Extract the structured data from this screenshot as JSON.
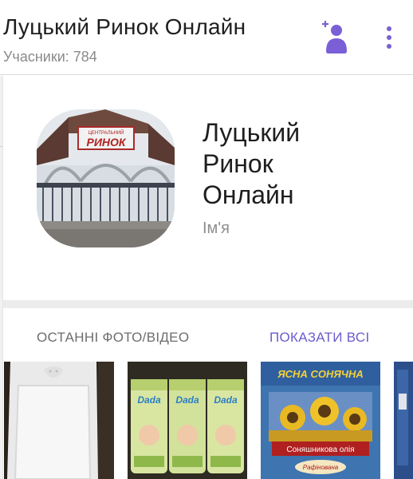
{
  "header": {
    "title": "Луцький Ринок Онлайн",
    "members_label": "Учасники: 784",
    "add_member_icon": "add-person-icon",
    "more_icon": "more-vertical-icon"
  },
  "profile": {
    "avatar_sign_text": "РИНОК",
    "avatar_sign_top_text": "ЦЕНТРАЛЬНИЙ",
    "name_lines": [
      "Луцький",
      "Ринок",
      "Онлайн"
    ],
    "name_caption": "Ім'я"
  },
  "media": {
    "title": "ОСТАННІ ФОТО/ВІДЕО",
    "show_all": "ПОКАЗАТИ ВСІ",
    "thumbnails": [
      {
        "description_icon": "baby-changing-mat-photo"
      },
      {
        "description_icon": "wet-wipes-photo",
        "product_label": "Dada"
      },
      {
        "description_icon": "sunflower-oil-photo",
        "product_top": "ЯСНА СОНЯЧНА",
        "product_label": "Соняшникова олія",
        "product_sub": "Рафінована"
      },
      {
        "description_icon": "partial-photo"
      }
    ]
  },
  "colors": {
    "accent": "#7a5fd6",
    "link": "#6b5ccf",
    "subtitle": "#8a8a8a"
  }
}
